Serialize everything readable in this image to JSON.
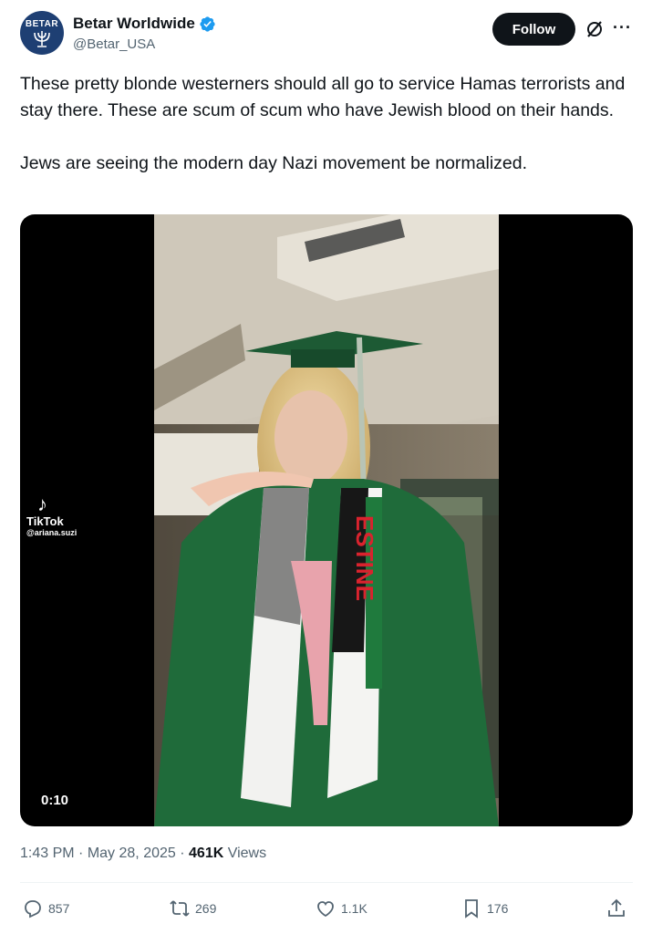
{
  "author": {
    "display_name": "Betar Worldwide",
    "handle": "@Betar_USA",
    "avatar_text": "BETAR",
    "verified_color": "#1d9bf0"
  },
  "header": {
    "follow_label": "Follow",
    "grok_icon": "grok-slash-icon",
    "more_icon": "ellipsis-icon"
  },
  "tweet": {
    "text": "These pretty blonde westerners should all go to service Hamas terrorists and stay there. These are scum of scum who have Jewish blood on their hands.\n\nJews are seeing the modern day Nazi movement be normalized."
  },
  "media": {
    "duration": "0:10",
    "watermark_app": "TikTok",
    "watermark_user": "@ariana.suzi",
    "scarf_text": "ESTINE"
  },
  "meta": {
    "time": "1:43 PM",
    "date": "May 28, 2025",
    "views_count": "461K",
    "views_label": "Views"
  },
  "actions": {
    "replies": "857",
    "reposts": "269",
    "likes": "1.1K",
    "bookmarks": "176"
  },
  "colors": {
    "text": "#0f1419",
    "secondary": "#536471",
    "accent": "#1d9bf0",
    "gown_green": "#1f6b3a"
  }
}
